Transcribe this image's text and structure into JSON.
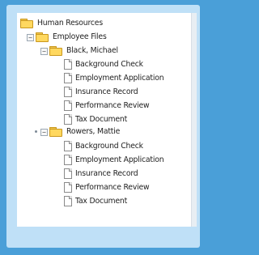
{
  "tree": {
    "root": "Human Resources",
    "files_folder": "Employee Files",
    "employees": [
      {
        "name": "Black, Michael",
        "documents": [
          "Background Check",
          "Employment Application",
          "Insurance Record",
          "Performance Review",
          "Tax Document"
        ]
      },
      {
        "name": "Rowers, Mattie",
        "documents": [
          "Background Check",
          "Employment Application",
          "Insurance Record",
          "Performance Review",
          "Tax Document"
        ]
      }
    ]
  }
}
